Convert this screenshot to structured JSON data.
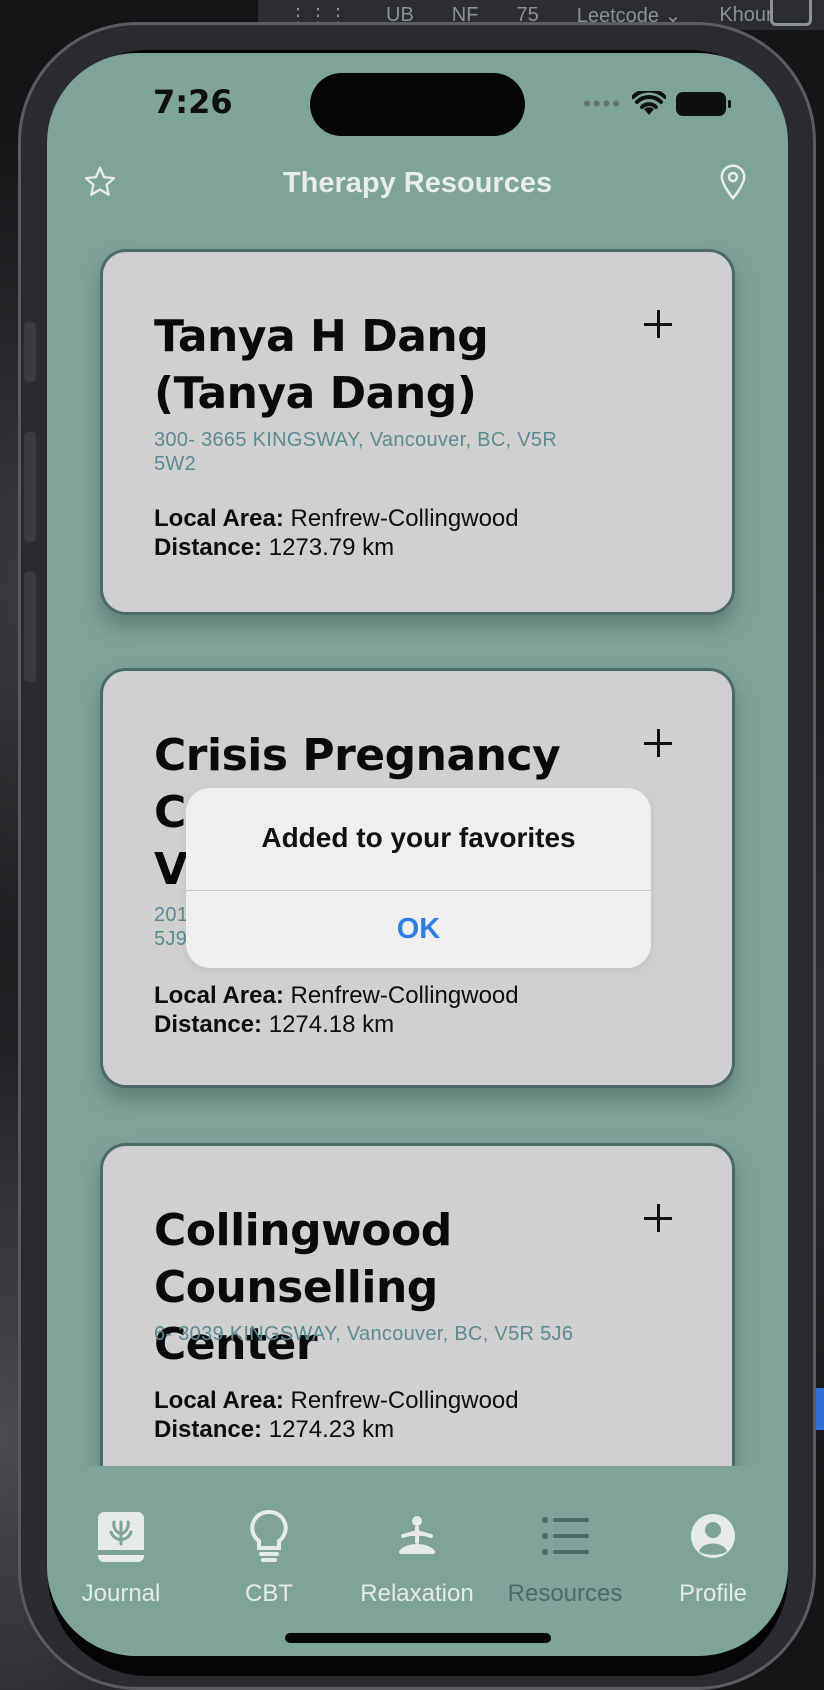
{
  "browser_toolbar": {
    "items": [
      "UB",
      "NF",
      "75",
      "Leetcode",
      "Khour"
    ]
  },
  "status_bar": {
    "time": "7:26",
    "signal": "signal-dots-icon",
    "wifi": "wifi-icon",
    "battery": "battery-icon"
  },
  "nav": {
    "title": "Therapy Resources",
    "left_icon": "star-icon",
    "right_icon": "map-pin-icon"
  },
  "cards": [
    {
      "title": "Tanya H Dang (Tanya Dang)",
      "address": "300- 3665 KINGSWAY, Vancouver, BC, V5R 5W2",
      "local_area_label": "Local Area:",
      "local_area": "Renfrew-Collingwood",
      "distance_label": "Distance:",
      "distance": "1273.79 km"
    },
    {
      "title": "Crisis Pregnancy Centre of Vancouver",
      "address": "201- 3550 KINGSWAY, Vancouver, BC, V5R 5J9",
      "local_area_label": "Local Area:",
      "local_area": "Renfrew-Collingwood",
      "distance_label": "Distance:",
      "distance": "1274.18 km"
    },
    {
      "title": "Collingwood Counselling Center",
      "address": "6- 3039 KINGSWAY, Vancouver, BC, V5R 5J6",
      "local_area_label": "Local Area:",
      "local_area": "Renfrew-Collingwood",
      "distance_label": "Distance:",
      "distance": "1274.23 km"
    }
  ],
  "alert": {
    "message": "Added to your favorites",
    "button": "OK"
  },
  "tabs": [
    {
      "label": "Journal",
      "icon": "journal-book-icon",
      "active": false
    },
    {
      "label": "CBT",
      "icon": "lightbulb-icon",
      "active": false
    },
    {
      "label": "Relaxation",
      "icon": "meditation-icon",
      "active": false
    },
    {
      "label": "Resources",
      "icon": "list-icon",
      "active": true
    },
    {
      "label": "Profile",
      "icon": "profile-person-icon",
      "active": false
    }
  ],
  "colors": {
    "screen_bg": "#7ea398",
    "card_bg": "#d0d0d0",
    "card_border": "#4c6a68",
    "address": "#5c8a91",
    "alert_button": "#2f7de1",
    "active_tab": "#4c6a68"
  }
}
